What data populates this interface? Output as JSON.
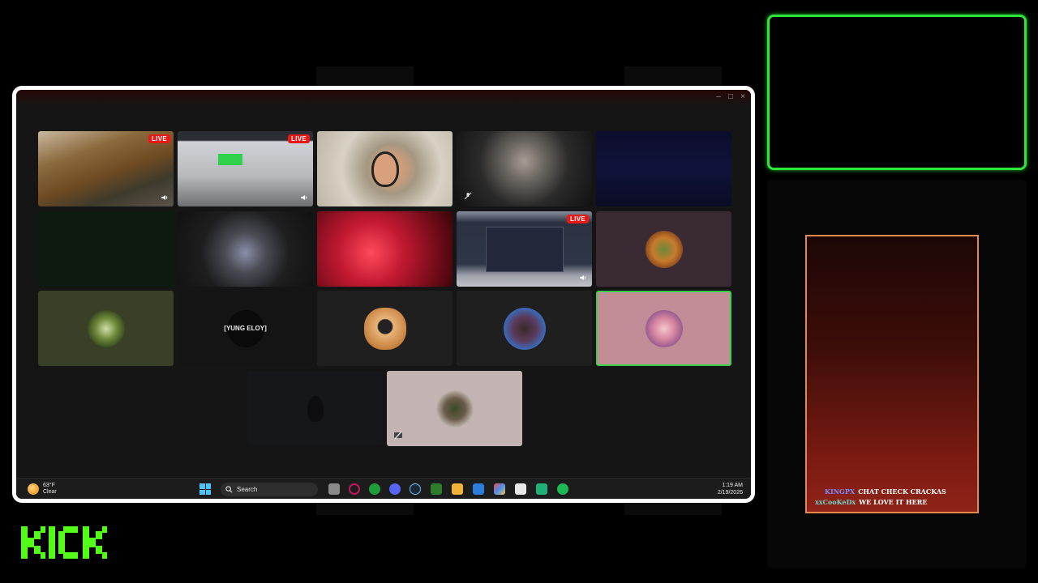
{
  "window": {
    "minimize": "–",
    "maximize": "□",
    "close": "×"
  },
  "tiles": {
    "live_label": "LIVE",
    "yung_eloy_label": "[YUNG ELOY]"
  },
  "taskbar": {
    "weather_temp": "63°F",
    "weather_cond": "Clear",
    "search_label": "Search",
    "time": "1:19 AM",
    "date": "2/19/2026"
  },
  "chat": {
    "messages": [
      {
        "user": "KINGPX",
        "text": "CHAT CHECK CRACKAS",
        "user_color": "#7e8cff"
      },
      {
        "user": "xxCooKeDx",
        "text": "WE LOVE IT HERE",
        "user_color": "#6fd3c8"
      }
    ]
  },
  "brand": {
    "logo_text": "KICK",
    "accent": "#53fc18",
    "cam_border": "#2ee53a"
  }
}
